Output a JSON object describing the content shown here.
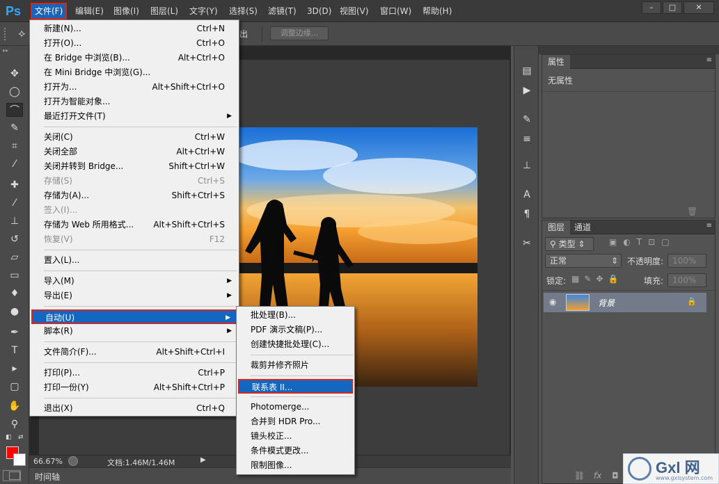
{
  "app": {
    "logo": "Ps",
    "menus": [
      "文件(F)",
      "编辑(E)",
      "图像(I)",
      "图层(L)",
      "文字(Y)",
      "选择(S)",
      "滤镜(T)",
      "3D(D)",
      "视图(V)",
      "窗口(W)",
      "帮助(H)"
    ],
    "window_buttons": [
      "–",
      "□",
      "✕"
    ]
  },
  "options_bar": {
    "partial_label": "出",
    "refine_edge": "调整边缘..."
  },
  "file_menu": [
    {
      "label": "新建(N)...",
      "shortcut": "Ctrl+N"
    },
    {
      "label": "打开(O)...",
      "shortcut": "Ctrl+O"
    },
    {
      "label": "在 Bridge 中浏览(B)...",
      "shortcut": "Alt+Ctrl+O"
    },
    {
      "label": "在 Mini Bridge 中浏览(G)...",
      "shortcut": ""
    },
    {
      "label": "打开为...",
      "shortcut": "Alt+Shift+Ctrl+O"
    },
    {
      "label": "打开为智能对象...",
      "shortcut": ""
    },
    {
      "label": "最近打开文件(T)",
      "shortcut": "",
      "submenu": true
    },
    {
      "sep": true
    },
    {
      "label": "关闭(C)",
      "shortcut": "Ctrl+W"
    },
    {
      "label": "关闭全部",
      "shortcut": "Alt+Ctrl+W"
    },
    {
      "label": "关闭并转到 Bridge...",
      "shortcut": "Shift+Ctrl+W"
    },
    {
      "label": "存储(S)",
      "shortcut": "Ctrl+S",
      "disabled": true
    },
    {
      "label": "存储为(A)...",
      "shortcut": "Shift+Ctrl+S"
    },
    {
      "label": "签入(I)...",
      "shortcut": "",
      "disabled": true
    },
    {
      "label": "存储为 Web 所用格式...",
      "shortcut": "Alt+Shift+Ctrl+S"
    },
    {
      "label": "恢复(V)",
      "shortcut": "F12",
      "disabled": true
    },
    {
      "sep": true
    },
    {
      "label": "置入(L)...",
      "shortcut": ""
    },
    {
      "sep": true
    },
    {
      "label": "导入(M)",
      "shortcut": "",
      "submenu": true
    },
    {
      "label": "导出(E)",
      "shortcut": "",
      "submenu": true
    },
    {
      "sep": true
    },
    {
      "label": "自动(U)",
      "shortcut": "",
      "submenu": true,
      "highlighted": true
    },
    {
      "label": "脚本(R)",
      "shortcut": "",
      "submenu": true
    },
    {
      "sep": true
    },
    {
      "label": "文件简介(F)...",
      "shortcut": "Alt+Shift+Ctrl+I"
    },
    {
      "sep": true
    },
    {
      "label": "打印(P)...",
      "shortcut": "Ctrl+P"
    },
    {
      "label": "打印一份(Y)",
      "shortcut": "Alt+Shift+Ctrl+P"
    },
    {
      "sep": true
    },
    {
      "label": "退出(X)",
      "shortcut": "Ctrl+Q"
    }
  ],
  "auto_submenu": [
    {
      "label": "批处理(B)..."
    },
    {
      "label": "PDF 演示文稿(P)..."
    },
    {
      "label": "创建快捷批处理(C)..."
    },
    {
      "sep": true
    },
    {
      "label": "裁剪并修齐照片"
    },
    {
      "sep": true
    },
    {
      "label": "联系表 II...",
      "highlighted": true
    },
    {
      "sep": true
    },
    {
      "label": "Photomerge..."
    },
    {
      "label": "合并到 HDR Pro..."
    },
    {
      "label": "镜头校正..."
    },
    {
      "label": "条件模式更改..."
    },
    {
      "label": "限制图像..."
    }
  ],
  "status": {
    "zoom": "66.67%",
    "doc_info": "文档:1.46M/1.46M",
    "timeline": "时间轴"
  },
  "properties_panel": {
    "tab": "属性",
    "content": "无属性"
  },
  "layers_panel": {
    "tabs": [
      "图层",
      "通道"
    ],
    "filter_kind": "类型",
    "blend_mode": "正常",
    "opacity_label": "不透明度:",
    "opacity_value": "100%",
    "lock_label": "锁定:",
    "fill_label": "填充:",
    "fill_value": "100%",
    "layer_name": "背景",
    "layer_fx": "fx"
  },
  "watermark": {
    "brand": "Gxl 网",
    "url": "www.gxlsystem.com"
  },
  "colors": {
    "foreground": "#ff0000",
    "background": "#ffffff",
    "highlight": "#1467c1",
    "callout": "#d9261c"
  }
}
